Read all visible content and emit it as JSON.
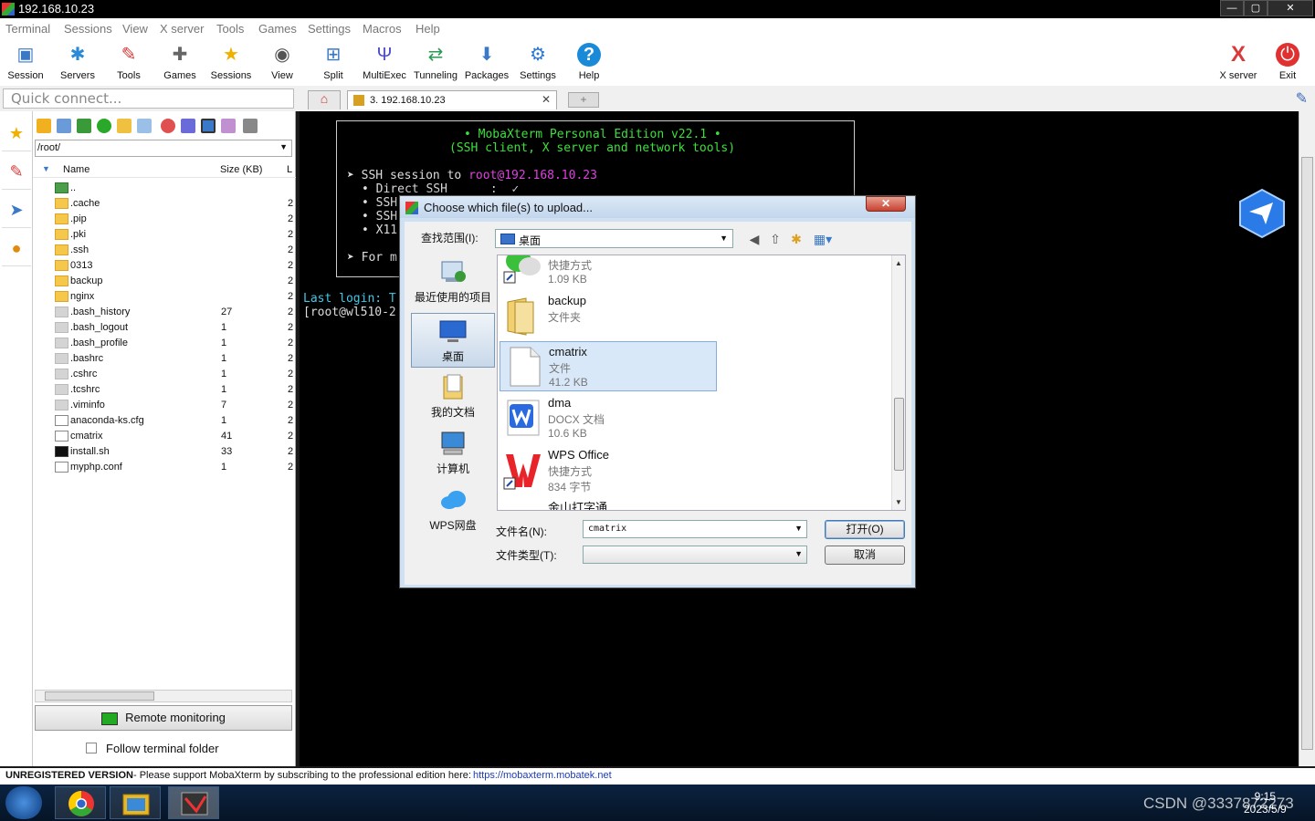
{
  "window": {
    "title": "192.168.10.23",
    "buttons": [
      "—",
      "▢",
      "✕"
    ]
  },
  "menu": [
    "Terminal",
    "Sessions",
    "View",
    "X server",
    "Tools",
    "Games",
    "Settings",
    "Macros",
    "Help"
  ],
  "toolbar": {
    "left": [
      {
        "label": "Session",
        "icon": "session-icon"
      },
      {
        "label": "Servers",
        "icon": "servers-icon"
      },
      {
        "label": "Tools",
        "icon": "tools-icon"
      },
      {
        "label": "Games",
        "icon": "games-icon"
      },
      {
        "label": "Sessions",
        "icon": "star-icon"
      },
      {
        "label": "View",
        "icon": "view-icon"
      },
      {
        "label": "Split",
        "icon": "split-icon"
      },
      {
        "label": "MultiExec",
        "icon": "multiexec-icon"
      },
      {
        "label": "Tunneling",
        "icon": "tunneling-icon"
      },
      {
        "label": "Packages",
        "icon": "packages-icon"
      },
      {
        "label": "Settings",
        "icon": "settings-icon"
      },
      {
        "label": "Help",
        "icon": "help-icon"
      }
    ],
    "xserver": "X server",
    "exit": "Exit"
  },
  "quick_connect": {
    "placeholder": "Quick connect..."
  },
  "tabs": {
    "session_label": "3. 192.168.10.23",
    "close": "✕",
    "new": "+"
  },
  "browser": {
    "path": "/root/",
    "columns": {
      "name": "Name",
      "size": "Size (KB)",
      "l": "L"
    },
    "files": [
      {
        "name": "..",
        "size": "",
        "kind": "up",
        "l": ""
      },
      {
        "name": ".cache",
        "size": "",
        "kind": "folder",
        "l": "2"
      },
      {
        "name": ".pip",
        "size": "",
        "kind": "folder",
        "l": "2"
      },
      {
        "name": ".pki",
        "size": "",
        "kind": "folder",
        "l": "2"
      },
      {
        "name": ".ssh",
        "size": "",
        "kind": "folder",
        "l": "2"
      },
      {
        "name": "0313",
        "size": "",
        "kind": "folder",
        "l": "2"
      },
      {
        "name": "backup",
        "size": "",
        "kind": "folder",
        "l": "2"
      },
      {
        "name": "nginx",
        "size": "",
        "kind": "folder",
        "l": "2"
      },
      {
        "name": ".bash_history",
        "size": "27",
        "kind": "hidden",
        "l": "2"
      },
      {
        "name": ".bash_logout",
        "size": "1",
        "kind": "hidden",
        "l": "2"
      },
      {
        "name": ".bash_profile",
        "size": "1",
        "kind": "hidden",
        "l": "2"
      },
      {
        "name": ".bashrc",
        "size": "1",
        "kind": "hidden",
        "l": "2"
      },
      {
        "name": ".cshrc",
        "size": "1",
        "kind": "hidden",
        "l": "2"
      },
      {
        "name": ".tcshrc",
        "size": "1",
        "kind": "hidden",
        "l": "2"
      },
      {
        "name": ".viminfo",
        "size": "7",
        "kind": "hidden",
        "l": "2"
      },
      {
        "name": "anaconda-ks.cfg",
        "size": "1",
        "kind": "text",
        "l": "2"
      },
      {
        "name": "cmatrix",
        "size": "41",
        "kind": "text",
        "l": "2"
      },
      {
        "name": "install.sh",
        "size": "33",
        "kind": "exec",
        "l": "2"
      },
      {
        "name": "myphp.conf",
        "size": "1",
        "kind": "text",
        "l": "2"
      }
    ],
    "remote_monitoring": "Remote monitoring",
    "follow_folder": "Follow terminal folder"
  },
  "terminal": {
    "banner_title": "• MobaXterm Personal Edition v22.1 •",
    "banner_sub": "(SSH client, X server and network tools)",
    "ssh_prefix": "➤ SSH session to ",
    "ssh_target": "root@192.168.10.23",
    "line_direct": "• Direct SSH      :  ✓",
    "line_ssh1": "• SSH",
    "line_ssh2": "• SSH",
    "line_x11": "• X11",
    "line_for": "➤ For m",
    "last_login": "Last login: T",
    "prompt": "[root@wl510-2"
  },
  "status": {
    "unregistered": "UNREGISTERED VERSION",
    "message": "-  Please support MobaXterm by subscribing to the professional edition here:",
    "link": "https://mobaxterm.mobatek.net"
  },
  "taskbar": {
    "time": "9:15",
    "date": "2023/5/9",
    "watermark": "CSDN @3337872273"
  },
  "dialog": {
    "title": "Choose which file(s) to upload...",
    "close": "✕",
    "lookin_label": "查找范围(I):",
    "lookin_value": "桌面",
    "places": [
      "最近使用的项目",
      "桌面",
      "我的文档",
      "计算机",
      "WPS网盘"
    ],
    "selected_place": "桌面",
    "files": [
      {
        "name": "",
        "type": "快捷方式",
        "size": "1.09 KB",
        "icon": "wechat-shortcut-icon"
      },
      {
        "name": "backup",
        "type": "文件夹",
        "size": "",
        "icon": "folder-icon"
      },
      {
        "name": "cmatrix",
        "type": "文件",
        "size": "41.2 KB",
        "icon": "file-icon"
      },
      {
        "name": "dma",
        "type": "DOCX 文档",
        "size": "10.6 KB",
        "icon": "docx-icon"
      },
      {
        "name": "WPS Office",
        "type": "快捷方式",
        "size": "834 字节",
        "icon": "wps-icon"
      },
      {
        "name": "金山打字通",
        "type": "",
        "size": "",
        "icon": "typing-icon"
      }
    ],
    "selected_file": "cmatrix",
    "filename_label": "文件名(N):",
    "filename_value": "cmatrix",
    "filetype_label": "文件类型(T):",
    "filetype_value": "",
    "open_button": "打开(O)",
    "cancel_button": "取消"
  }
}
